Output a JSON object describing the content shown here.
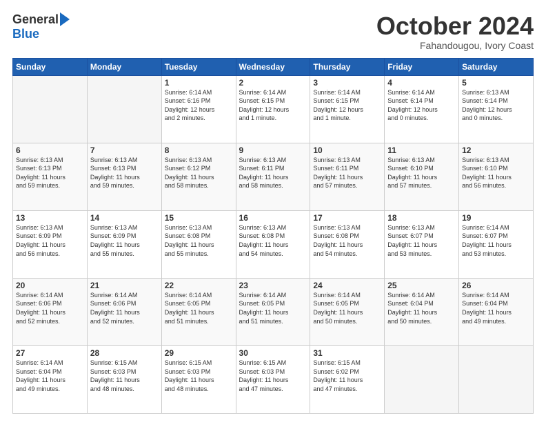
{
  "logo": {
    "general": "General",
    "blue": "Blue"
  },
  "header": {
    "month": "October 2024",
    "location": "Fahandougou, Ivory Coast"
  },
  "weekdays": [
    "Sunday",
    "Monday",
    "Tuesday",
    "Wednesday",
    "Thursday",
    "Friday",
    "Saturday"
  ],
  "weeks": [
    [
      {
        "day": "",
        "info": ""
      },
      {
        "day": "",
        "info": ""
      },
      {
        "day": "1",
        "info": "Sunrise: 6:14 AM\nSunset: 6:16 PM\nDaylight: 12 hours\nand 2 minutes."
      },
      {
        "day": "2",
        "info": "Sunrise: 6:14 AM\nSunset: 6:15 PM\nDaylight: 12 hours\nand 1 minute."
      },
      {
        "day": "3",
        "info": "Sunrise: 6:14 AM\nSunset: 6:15 PM\nDaylight: 12 hours\nand 1 minute."
      },
      {
        "day": "4",
        "info": "Sunrise: 6:14 AM\nSunset: 6:14 PM\nDaylight: 12 hours\nand 0 minutes."
      },
      {
        "day": "5",
        "info": "Sunrise: 6:13 AM\nSunset: 6:14 PM\nDaylight: 12 hours\nand 0 minutes."
      }
    ],
    [
      {
        "day": "6",
        "info": "Sunrise: 6:13 AM\nSunset: 6:13 PM\nDaylight: 11 hours\nand 59 minutes."
      },
      {
        "day": "7",
        "info": "Sunrise: 6:13 AM\nSunset: 6:13 PM\nDaylight: 11 hours\nand 59 minutes."
      },
      {
        "day": "8",
        "info": "Sunrise: 6:13 AM\nSunset: 6:12 PM\nDaylight: 11 hours\nand 58 minutes."
      },
      {
        "day": "9",
        "info": "Sunrise: 6:13 AM\nSunset: 6:11 PM\nDaylight: 11 hours\nand 58 minutes."
      },
      {
        "day": "10",
        "info": "Sunrise: 6:13 AM\nSunset: 6:11 PM\nDaylight: 11 hours\nand 57 minutes."
      },
      {
        "day": "11",
        "info": "Sunrise: 6:13 AM\nSunset: 6:10 PM\nDaylight: 11 hours\nand 57 minutes."
      },
      {
        "day": "12",
        "info": "Sunrise: 6:13 AM\nSunset: 6:10 PM\nDaylight: 11 hours\nand 56 minutes."
      }
    ],
    [
      {
        "day": "13",
        "info": "Sunrise: 6:13 AM\nSunset: 6:09 PM\nDaylight: 11 hours\nand 56 minutes."
      },
      {
        "day": "14",
        "info": "Sunrise: 6:13 AM\nSunset: 6:09 PM\nDaylight: 11 hours\nand 55 minutes."
      },
      {
        "day": "15",
        "info": "Sunrise: 6:13 AM\nSunset: 6:08 PM\nDaylight: 11 hours\nand 55 minutes."
      },
      {
        "day": "16",
        "info": "Sunrise: 6:13 AM\nSunset: 6:08 PM\nDaylight: 11 hours\nand 54 minutes."
      },
      {
        "day": "17",
        "info": "Sunrise: 6:13 AM\nSunset: 6:08 PM\nDaylight: 11 hours\nand 54 minutes."
      },
      {
        "day": "18",
        "info": "Sunrise: 6:13 AM\nSunset: 6:07 PM\nDaylight: 11 hours\nand 53 minutes."
      },
      {
        "day": "19",
        "info": "Sunrise: 6:14 AM\nSunset: 6:07 PM\nDaylight: 11 hours\nand 53 minutes."
      }
    ],
    [
      {
        "day": "20",
        "info": "Sunrise: 6:14 AM\nSunset: 6:06 PM\nDaylight: 11 hours\nand 52 minutes."
      },
      {
        "day": "21",
        "info": "Sunrise: 6:14 AM\nSunset: 6:06 PM\nDaylight: 11 hours\nand 52 minutes."
      },
      {
        "day": "22",
        "info": "Sunrise: 6:14 AM\nSunset: 6:05 PM\nDaylight: 11 hours\nand 51 minutes."
      },
      {
        "day": "23",
        "info": "Sunrise: 6:14 AM\nSunset: 6:05 PM\nDaylight: 11 hours\nand 51 minutes."
      },
      {
        "day": "24",
        "info": "Sunrise: 6:14 AM\nSunset: 6:05 PM\nDaylight: 11 hours\nand 50 minutes."
      },
      {
        "day": "25",
        "info": "Sunrise: 6:14 AM\nSunset: 6:04 PM\nDaylight: 11 hours\nand 50 minutes."
      },
      {
        "day": "26",
        "info": "Sunrise: 6:14 AM\nSunset: 6:04 PM\nDaylight: 11 hours\nand 49 minutes."
      }
    ],
    [
      {
        "day": "27",
        "info": "Sunrise: 6:14 AM\nSunset: 6:04 PM\nDaylight: 11 hours\nand 49 minutes."
      },
      {
        "day": "28",
        "info": "Sunrise: 6:15 AM\nSunset: 6:03 PM\nDaylight: 11 hours\nand 48 minutes."
      },
      {
        "day": "29",
        "info": "Sunrise: 6:15 AM\nSunset: 6:03 PM\nDaylight: 11 hours\nand 48 minutes."
      },
      {
        "day": "30",
        "info": "Sunrise: 6:15 AM\nSunset: 6:03 PM\nDaylight: 11 hours\nand 47 minutes."
      },
      {
        "day": "31",
        "info": "Sunrise: 6:15 AM\nSunset: 6:02 PM\nDaylight: 11 hours\nand 47 minutes."
      },
      {
        "day": "",
        "info": ""
      },
      {
        "day": "",
        "info": ""
      }
    ]
  ]
}
